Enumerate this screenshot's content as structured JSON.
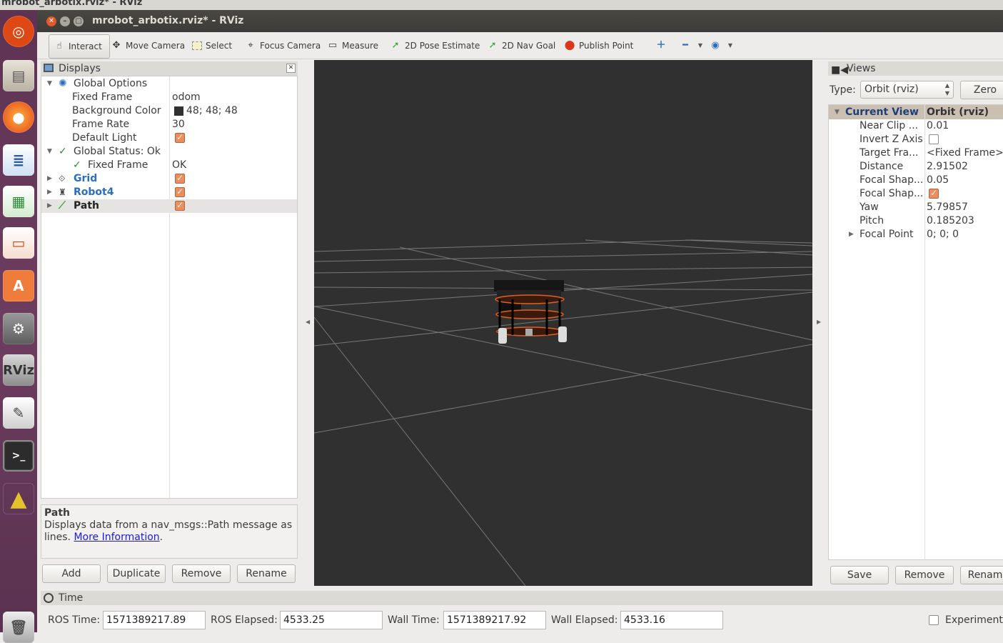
{
  "os_title": "mrobot_arbotix.rviz* - RViz",
  "window": {
    "title": "mrobot_arbotix.rviz* - RViz"
  },
  "toolbar": {
    "interact": "Interact",
    "move_camera": "Move Camera",
    "select": "Select",
    "focus_camera": "Focus Camera",
    "measure": "Measure",
    "pose_estimate": "2D Pose Estimate",
    "nav_goal": "2D Nav Goal",
    "publish_point": "Publish Point"
  },
  "displays": {
    "title": "Displays",
    "global_options": "Global Options",
    "fixed_frame_label": "Fixed Frame",
    "fixed_frame_value": "odom",
    "bg_color_label": "Background Color",
    "bg_color_value": "48; 48; 48",
    "bg_color_swatch": "#303030",
    "frame_rate_label": "Frame Rate",
    "frame_rate_value": "30",
    "default_light_label": "Default Light",
    "global_status": "Global Status: Ok",
    "status_fixed_frame": "Fixed Frame",
    "status_fixed_frame_value": "OK",
    "grid": "Grid",
    "robot": "Robot4",
    "path": "Path",
    "desc_title": "Path",
    "desc_text": "Displays data from a nav_msgs::Path message as lines.",
    "desc_link": "More Information",
    "desc_period": ".",
    "add": "Add",
    "duplicate": "Duplicate",
    "remove": "Remove",
    "rename": "Rename"
  },
  "views": {
    "title": "Views",
    "type_label": "Type:",
    "type_value": "Orbit (rviz)",
    "zero": "Zero",
    "current_view": "Current View",
    "current_view_type": "Orbit (rviz)",
    "props": [
      {
        "name": "Near Clip ...",
        "value": "0.01"
      },
      {
        "name": "Invert Z Axis",
        "value": ""
      },
      {
        "name": "Target Fra...",
        "value": "<Fixed Frame>"
      },
      {
        "name": "Distance",
        "value": "2.91502"
      },
      {
        "name": "Focal Shap...",
        "value": "0.05"
      },
      {
        "name": "Focal Shap...",
        "value": ""
      },
      {
        "name": "Yaw",
        "value": "5.79857"
      },
      {
        "name": "Pitch",
        "value": "0.185203"
      },
      {
        "name": "Focal Point",
        "value": "0; 0; 0"
      }
    ],
    "save": "Save",
    "remove": "Remove",
    "rename": "Renam"
  },
  "time": {
    "title": "Time",
    "ros_time_label": "ROS Time:",
    "ros_time": "1571389217.89",
    "ros_elapsed_label": "ROS Elapsed:",
    "ros_elapsed": "4533.25",
    "wall_time_label": "Wall Time:",
    "wall_time": "1571389217.92",
    "wall_elapsed_label": "Wall Elapsed:",
    "wall_elapsed": "4533.16",
    "experimental": "Experimenta"
  },
  "colors": {
    "accent_link": "#1a5fb4",
    "grid_blue": "#2a6ebd",
    "checkbox": "#f08c5a"
  }
}
